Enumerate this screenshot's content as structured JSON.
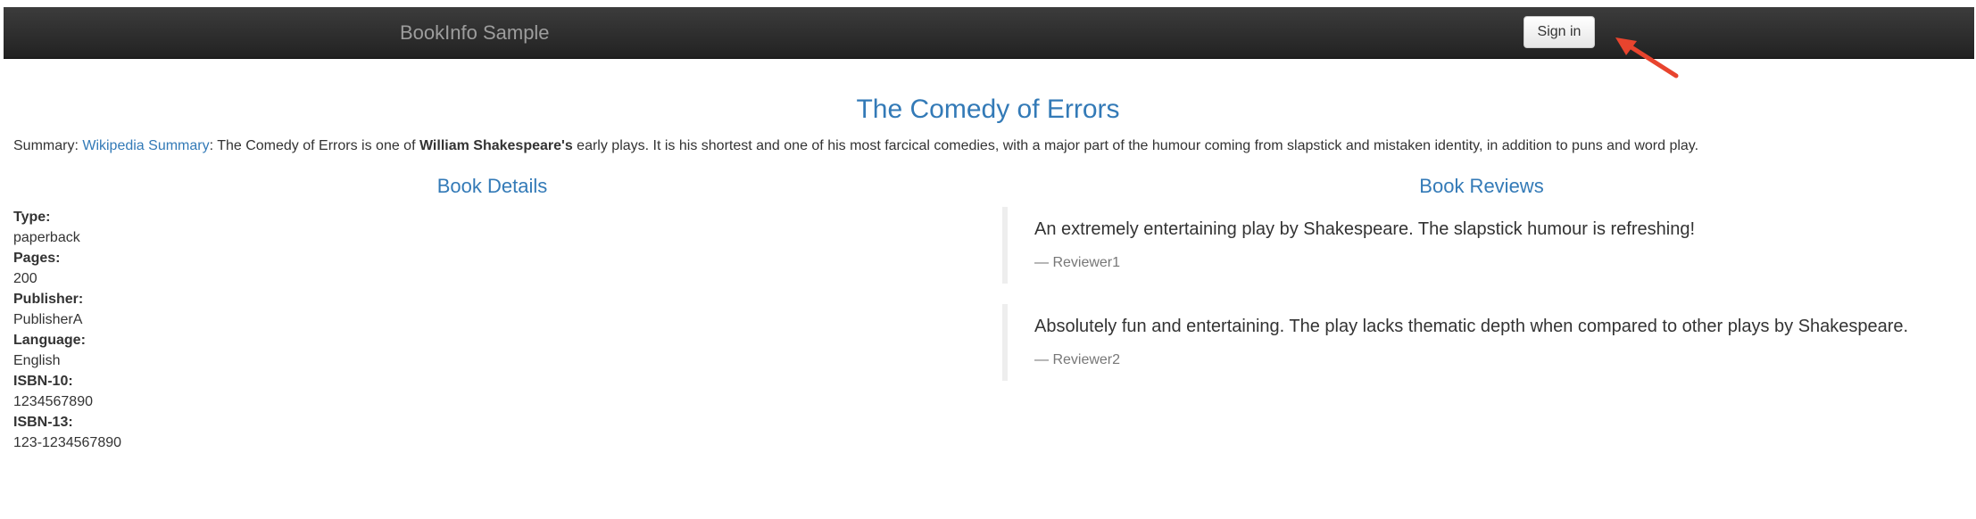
{
  "navbar": {
    "brand": "BookInfo Sample",
    "sign_in_label": "Sign in"
  },
  "product": {
    "title": "The Comedy of Errors",
    "summary_prefix": "Summary: ",
    "summary_link": "Wikipedia Summary",
    "summary_text_1": ": The Comedy of Errors is one of ",
    "summary_bold": "William Shakespeare's",
    "summary_text_2": " early plays. It is his shortest and one of his most farcical comedies, with a major part of the humour coming from slapstick and mistaken identity, in addition to puns and word play."
  },
  "details": {
    "heading": "Book Details",
    "fields": [
      {
        "label": "Type:",
        "value": "paperback"
      },
      {
        "label": "Pages:",
        "value": "200"
      },
      {
        "label": "Publisher:",
        "value": "PublisherA"
      },
      {
        "label": "Language:",
        "value": "English"
      },
      {
        "label": "ISBN-10:",
        "value": "1234567890"
      },
      {
        "label": "ISBN-13:",
        "value": "123-1234567890"
      }
    ]
  },
  "reviews": {
    "heading": "Book Reviews",
    "items": [
      {
        "text": "An extremely entertaining play by Shakespeare. The slapstick humour is refreshing!",
        "reviewer": "— Reviewer1"
      },
      {
        "text": "Absolutely fun and entertaining. The play lacks thematic depth when compared to other plays by Shakespeare.",
        "reviewer": "— Reviewer2"
      }
    ]
  },
  "colors": {
    "accent": "#337ab7",
    "navbar": "#222222",
    "annotation": "#e8442e"
  }
}
